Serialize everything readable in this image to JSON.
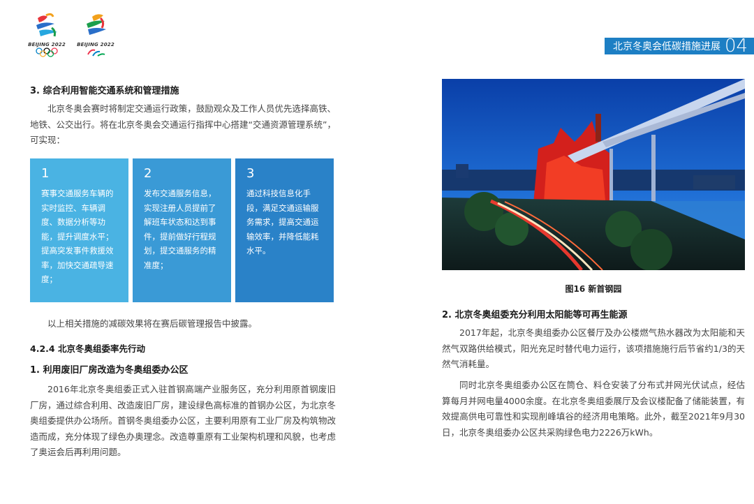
{
  "logos": [
    {
      "label": "BEIJING 2022",
      "icon": "olympic-rings-icon"
    },
    {
      "label": "BEIJING 2022",
      "icon": "paralympic-agitos-icon"
    }
  ],
  "header": {
    "title": "北京冬奥会低碳措施进展",
    "chapter": "04"
  },
  "left": {
    "section3_heading": "3. 综合利用智能交通系统和管理措施",
    "section3_para": "北京冬奥会赛时将制定交通运行政策，鼓励观众及工作人员优先选择高铁、地铁、公交出行。将在北京冬奥会交通运行指挥中心搭建“交通资源管理系统”，可实现：",
    "boxes": [
      {
        "num": "1",
        "text": "赛事交通服务车辆的实时监控、车辆调度、数据分析等功能，提升调度水平；提高突发事件救援效率，加快交通疏导速度；"
      },
      {
        "num": "2",
        "text": "发布交通服务信息，实现注册人员提前了解班车状态和达到事件，提前做好行程规划，提交通服务的精准度；"
      },
      {
        "num": "3",
        "text": "通过科技信息化手段，满足交通运输服务需求，提高交通运输效率，并降低能耗水平。"
      }
    ],
    "after_boxes": "以上相关措施的减碳效果将在赛后碳管理报告中披露。",
    "subsection_heading": "4.2.4 北京冬奥组委率先行动",
    "item1_heading": "1. 利用废旧厂房改造为冬奥组委办公区",
    "item1_para": "2016年北京冬奥组委正式入驻首钢高端产业服务区，充分利用原首钢废旧厂房，通过综合利用、改造废旧厂房，建设绿色高标准的首钢办公区，为北京冬奥组委提供办公场所。首钢冬奥组委办公区，主要利用原有工业厂房及构筑物改造而成，充分体现了绿色办奥理念。改造尊重原有工业架构机理和风貌，也考虑了奥运会后再利用问题。"
  },
  "right": {
    "figure_caption": "图16 新首钢园",
    "item2_heading": "2. 北京冬奥组委充分利用太阳能等可再生能源",
    "item2_para1": "2017年起，北京冬奥组委办公区餐厅及办公楼燃气热水器改为太阳能和天然气双路供给模式，阳光充足时替代电力运行，该项措施施行后节省约1/3的天然气消耗量。",
    "item2_para2": "同时北京冬奥组委办公区在筒仓、料仓安装了分布式并网光伏试点，经估算每月并网电量4000余度。在北京冬奥组委展厅及会议楼配备了储能装置，有效提高供电可靠性和实现削峰填谷的经济用电策略。此外，截至2021年9月30日，北京冬奥组委办公区共采购绿色电力2226万kWh。"
  },
  "colors": {
    "accent": "#1d7fc4",
    "box1": "#4ab3e3",
    "box2": "#3a9ad6",
    "box3": "#2a82c8"
  }
}
